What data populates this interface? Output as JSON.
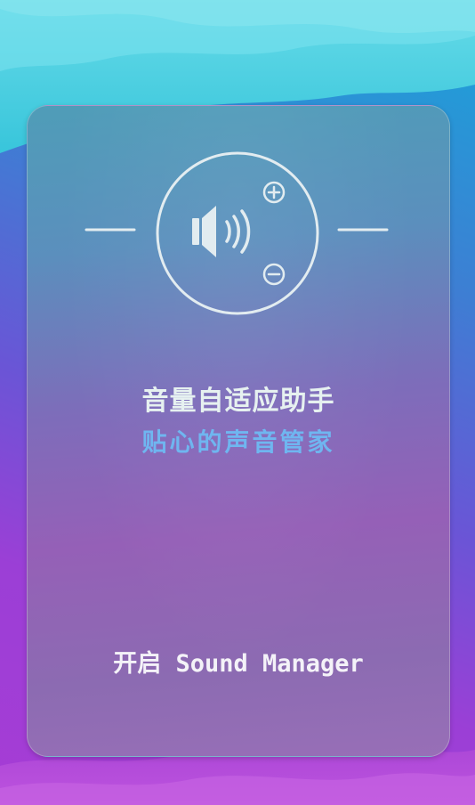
{
  "background": {
    "top_color": "#4fd0e3",
    "bottom_color": "#a63cd5"
  },
  "card": {
    "logo_icon": "speaker-volume-icon",
    "title": "音量自适应助手",
    "subtitle": "贴心的声音管家",
    "start_label": "开启 Sound Manager"
  },
  "colors": {
    "title_text": "#e6f1f0",
    "subtitle_text": "#6fb6f0",
    "icon_stroke": "#e2ecf0"
  }
}
